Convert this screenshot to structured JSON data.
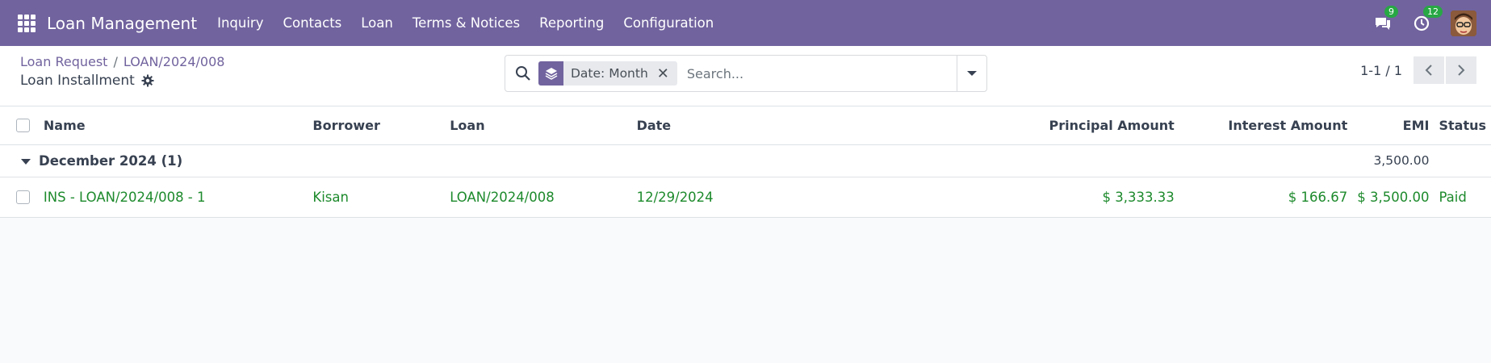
{
  "navbar": {
    "brand": "Loan Management",
    "menu": [
      "Inquiry",
      "Contacts",
      "Loan",
      "Terms & Notices",
      "Reporting",
      "Configuration"
    ],
    "messages_badge": "9",
    "activities_badge": "12",
    "icons": [
      "apps-grid-icon",
      "chat-icon",
      "clock-icon",
      "user-avatar"
    ],
    "accent_color": "#71639e"
  },
  "breadcrumb": {
    "parent": "Loan Request",
    "separator": "/",
    "current": "LOAN/2024/008"
  },
  "page_title": "Loan Installment",
  "search": {
    "facet_label": "Date: Month",
    "placeholder": "Search..."
  },
  "pager": {
    "value": "1-1 / 1"
  },
  "table": {
    "columns": [
      "Name",
      "Borrower",
      "Loan",
      "Date",
      "Principal Amount",
      "Interest Amount",
      "EMI",
      "Status"
    ],
    "groups": [
      {
        "label": "December 2024 (1)",
        "emi_total": "3,500.00",
        "rows": [
          {
            "name": "INS - LOAN/2024/008 - 1",
            "borrower": "Kisan",
            "loan": "LOAN/2024/008",
            "date": "12/29/2024",
            "principal": "$ 3,333.33",
            "interest": "$ 166.67",
            "emi": "$ 3,500.00",
            "status": "Paid"
          }
        ]
      }
    ],
    "row_text_color": "#1d8a2c"
  }
}
